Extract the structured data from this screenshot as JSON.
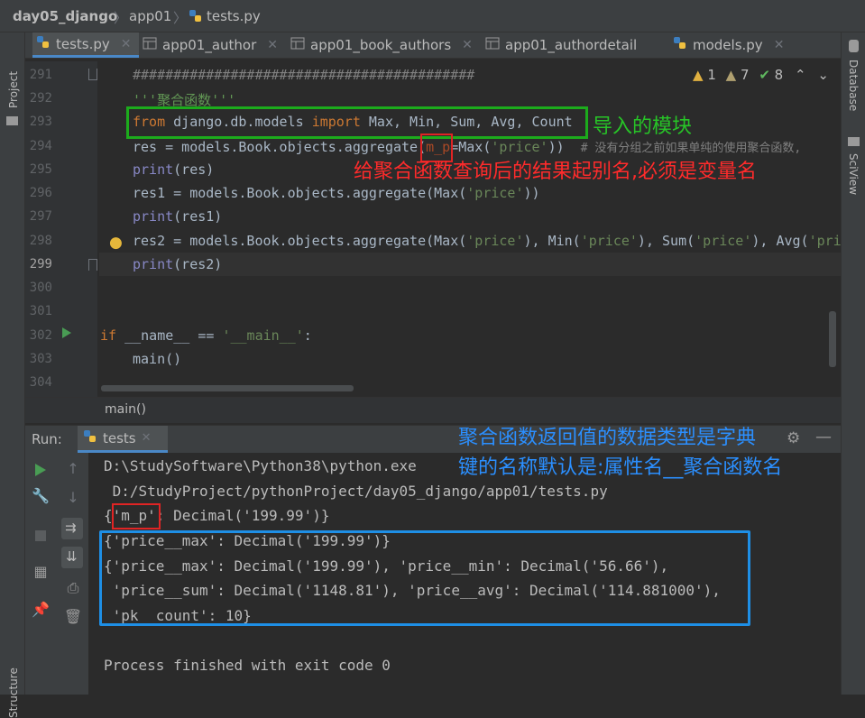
{
  "breadcrumb": {
    "project": "day05_django",
    "folder": "app01",
    "file": "tests.py"
  },
  "left_strip": {
    "project": "Project",
    "structure": "Structure"
  },
  "right_strip": {
    "database": "Database",
    "sciview": "SciView"
  },
  "tabs": [
    {
      "label": "tests.py",
      "icon": "python-file-icon",
      "active": true,
      "closable": true
    },
    {
      "label": "app01_author",
      "icon": "table-icon",
      "active": false,
      "closable": true
    },
    {
      "label": "app01_book_authors",
      "icon": "table-icon",
      "active": false,
      "closable": true
    },
    {
      "label": "app01_authordetail",
      "icon": "table-icon",
      "active": false,
      "closable": false
    },
    {
      "label": "models.py",
      "icon": "python-file-icon",
      "active": false,
      "closable": true
    }
  ],
  "inspections": {
    "warnings": "1",
    "weak_warnings": "7",
    "ok": "8"
  },
  "editor": {
    "line_numbers": [
      "291",
      "292",
      "293",
      "294",
      "295",
      "296",
      "297",
      "298",
      "299",
      "300",
      "301",
      "302",
      "303",
      "304"
    ],
    "current_line": "299",
    "lines": {
      "l291": "##########################################",
      "l292": "'''聚合函数'''",
      "l293_kw1": "from",
      "l293_mid": " django.db.models ",
      "l293_kw2": "import",
      "l293_rest": " Max, Min, Sum, Avg, Count",
      "l294_a": "res = models.Book.objects.aggregate(",
      "l294_b": "m_p",
      "l294_c": "=Max(",
      "l294_str": "'price'",
      "l294_d": "))  ",
      "l294_cmt": "# 没有分组之前如果单纯的使用聚合函数,",
      "l295_fn": "print",
      "l295_rest": "(res)",
      "l296_a": "res1 = models.Book.objects.aggregate(Max(",
      "l296_str": "'price'",
      "l296_b": "))",
      "l297_fn": "print",
      "l297_rest": "(res1)",
      "l298_a": "res2 = models.Book.objects.aggregate(Max(",
      "l298_s1": "'price'",
      "l298_b": "), Min(",
      "l298_s2": "'price'",
      "l298_c": "), Sum(",
      "l298_s3": "'price'",
      "l298_d": "), Avg(",
      "l298_s4": "'pri",
      "l299_fn": "print",
      "l299_rest": "(res2)",
      "l302_kw": "if",
      "l302_a": " __name__ == ",
      "l302_str": "'__main__'",
      "l302_b": ":",
      "l303": "main()"
    }
  },
  "annotations": {
    "green": "导入的模块",
    "red": "给聚合函数查询后的结果起别名,必须是变量名",
    "blue_line1": "聚合函数返回值的数据类型是字典",
    "blue_line2": "键的名称默认是:属性名__聚合函数名"
  },
  "structure_bar": {
    "label": "main()"
  },
  "run": {
    "label": "Run:",
    "tab": "tests",
    "console": [
      "D:\\StudySoftware\\Python38\\python.exe",
      " D:/StudyProject/pythonProject/day05_django/app01/tests.py",
      "{'m_p': Decimal('199.99')}",
      "{'price__max': Decimal('199.99')}",
      "{'price__max': Decimal('199.99'), 'price__min': Decimal('56.66'),",
      " 'price__sum': Decimal('1148.81'), 'price__avg': Decimal('114.881000'),",
      " 'pk__count': 10}",
      "",
      "Process finished with exit code 0"
    ]
  },
  "colors": {
    "editor_bg": "#2b2b2b",
    "keyword": "#cc7832",
    "string": "#6a8759",
    "annotation_green": "#27c427",
    "annotation_red": "#ff2b2b",
    "annotation_blue": "#2b8fff"
  }
}
